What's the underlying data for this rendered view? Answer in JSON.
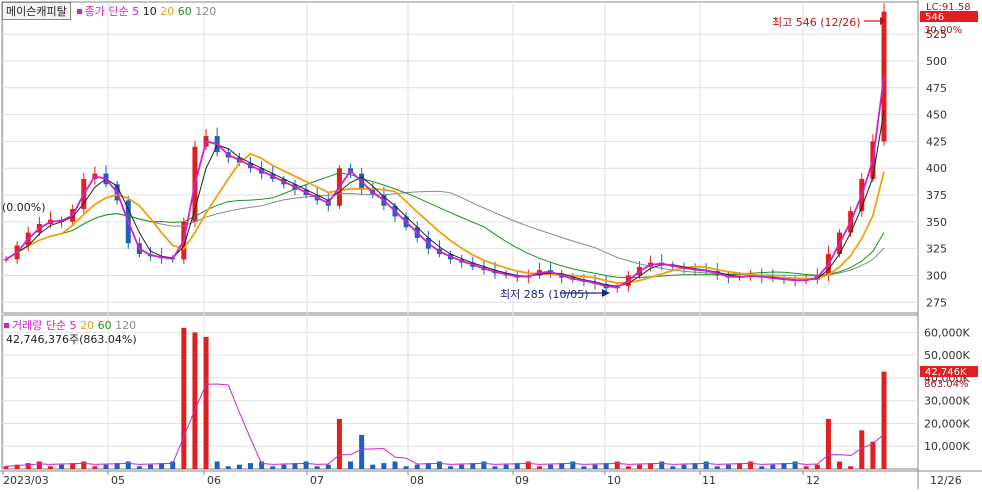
{
  "stock_name": "메이슨캐피탈",
  "price_legend": {
    "label": "종가 단순",
    "periods": [
      "5",
      "10",
      "20",
      "60",
      "120"
    ]
  },
  "volume_legend": {
    "label": "거래량 단순",
    "periods": [
      "5",
      "20",
      "60",
      "120"
    ]
  },
  "left_pct_label": "(0.00%)",
  "high_annotation": "최고 546 (12/26)",
  "low_annotation": "최저 285 (10/05)",
  "volume_readout": "42,746,376주(863.04%)",
  "top_right_label": "LC:91.58",
  "current_price_badge": "546",
  "current_pct_badge": "30.00%",
  "current_volume_badge": "42,746K",
  "current_volume_pct": "863.04%",
  "price_ticks": [
    "525",
    "500",
    "475",
    "450",
    "425",
    "400",
    "375",
    "350",
    "325",
    "300",
    "275"
  ],
  "volume_ticks": [
    "60,000K",
    "50,000K",
    "40,000K",
    "30,000K",
    "20,000K",
    "10,000K"
  ],
  "date_labels": [
    "2023/03",
    "05",
    "06",
    "07",
    "08",
    "09",
    "10",
    "11",
    "12",
    "12/26"
  ],
  "colors": {
    "up": "#e02020",
    "down": "#1f5fbf",
    "ma5": "#d020d0",
    "ma10": "#222222",
    "ma20": "#f0a010",
    "ma60": "#209020",
    "ma120": "#8a8a8a",
    "badge": "#e02020"
  },
  "chart_data": {
    "type": "candlestick",
    "y_range": [
      265,
      555
    ],
    "volume_range_k": [
      0,
      65000
    ],
    "current_price": 546,
    "high": {
      "value": 546,
      "date": "12/26"
    },
    "low": {
      "value": 285,
      "date": "10/05"
    },
    "price_series": [
      315,
      328,
      340,
      348,
      352,
      350,
      362,
      390,
      395,
      385,
      370,
      330,
      320,
      318,
      316,
      315,
      350,
      420,
      430,
      415,
      410,
      405,
      400,
      395,
      390,
      385,
      380,
      375,
      370,
      365,
      400,
      395,
      380,
      375,
      365,
      355,
      345,
      335,
      325,
      320,
      315,
      312,
      308,
      305,
      302,
      300,
      298,
      300,
      305,
      302,
      298,
      296,
      294,
      292,
      288,
      290,
      300,
      308,
      312,
      310,
      308,
      306,
      305,
      304,
      300,
      298,
      299,
      300,
      298,
      297,
      296,
      295,
      296,
      300,
      320,
      340,
      360,
      390,
      425,
      546
    ]
  }
}
